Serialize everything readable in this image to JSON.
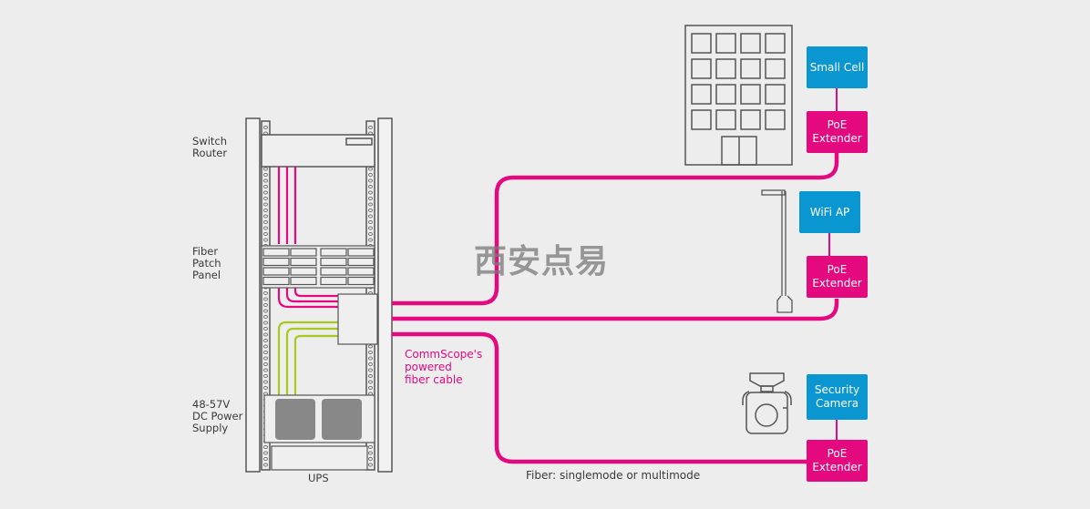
{
  "colors": {
    "cable": "#e5097f",
    "power": "#a8c81a",
    "device": "#0a96d1",
    "outline": "#555555",
    "background": "#ededed"
  },
  "rack_labels": {
    "switch_router": [
      "Switch",
      "Router"
    ],
    "fiber_patch_panel": [
      "Fiber",
      "Patch",
      "Panel"
    ],
    "power_supply": [
      "48-57V",
      "DC Power",
      "Supply"
    ],
    "ups": "UPS"
  },
  "cable_label": [
    "CommScope's",
    "powered",
    "fiber cable"
  ],
  "fiber_note": "Fiber: singlemode or multimode",
  "watermark": "西安点易",
  "endpoints": [
    {
      "device": "Small Cell",
      "extender": [
        "PoE",
        "Extender"
      ],
      "icon": "building-icon"
    },
    {
      "device": "WiFi AP",
      "extender": [
        "PoE",
        "Extender"
      ],
      "icon": "pole-antenna-icon"
    },
    {
      "device": [
        "Security",
        "Camera"
      ],
      "extender": [
        "PoE",
        "Extender"
      ],
      "icon": "security-camera-icon"
    }
  ]
}
